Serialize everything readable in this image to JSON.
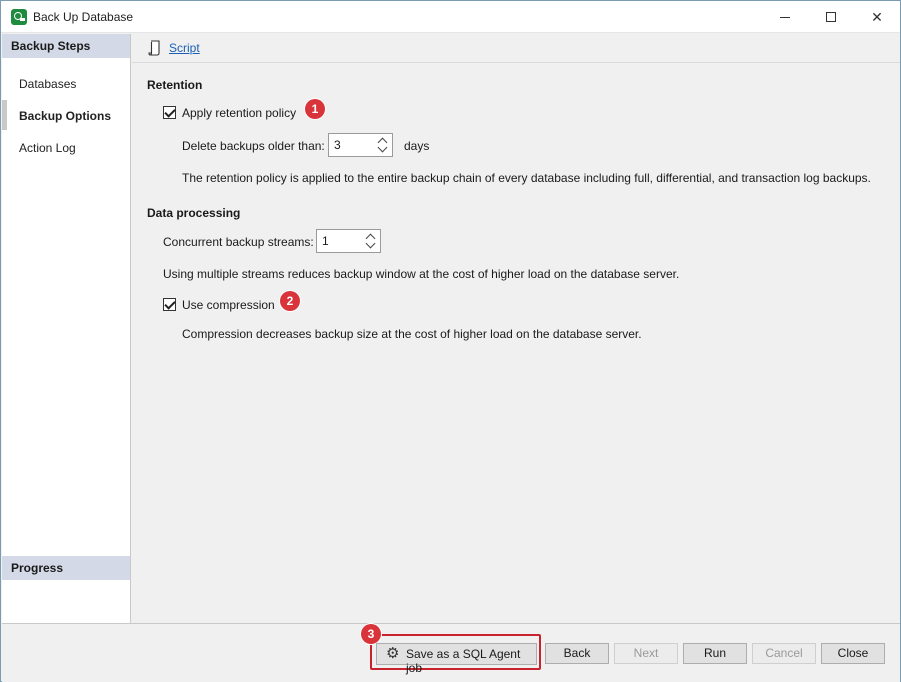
{
  "window": {
    "title": "Back Up Database",
    "icon": "database-backup-icon"
  },
  "sidebar": {
    "header": "Backup Steps",
    "items": [
      {
        "label": "Databases"
      },
      {
        "label": "Backup Options"
      },
      {
        "label": "Action Log"
      }
    ],
    "progress_header": "Progress"
  },
  "toolbar": {
    "script_label": "Script",
    "script_icon": "script-scroll-icon"
  },
  "retention": {
    "title": "Retention",
    "apply_label": "Apply retention policy",
    "apply_checked": true,
    "delete_label": "Delete backups older than:",
    "delete_value": "3",
    "delete_unit": "days",
    "note": "The retention policy is applied to the entire backup chain of every database including full, differential, and transaction log backups."
  },
  "processing": {
    "title": "Data processing",
    "streams_label": "Concurrent backup streams:",
    "streams_value": "1",
    "streams_note": "Using multiple streams reduces backup window at the cost of higher load on the database server.",
    "compression_label": "Use compression",
    "compression_checked": true,
    "compression_note": "Compression decreases backup size at the cost of higher load on the database server."
  },
  "badges": [
    "1",
    "2",
    "3"
  ],
  "footer": {
    "agent_label": "Save as a SQL Agent job",
    "back": "Back",
    "next": "Next",
    "run": "Run",
    "cancel": "Cancel",
    "close": "Close"
  },
  "colors": {
    "badge": "#d9343a",
    "highlight_frame": "#c8232c",
    "sidebar_header": "#d3d9e6",
    "link": "#1a5fb4"
  }
}
